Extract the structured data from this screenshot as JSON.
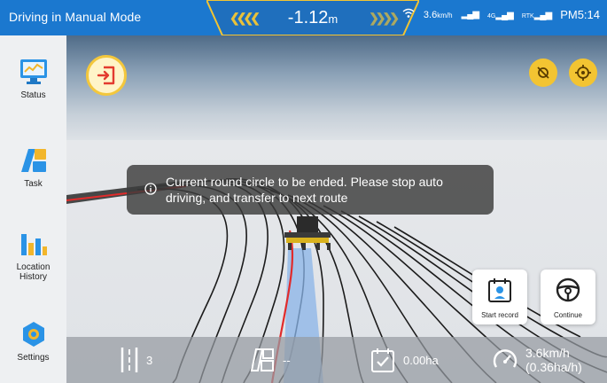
{
  "topbar": {
    "mode_title": "Driving in Manual Mode",
    "offset_value": "-1.12",
    "offset_unit": "m",
    "speed_small": "3.6",
    "speed_small_unit": "km/h",
    "net_label": "4G",
    "rtk_label": "RTK",
    "time": "PM5:14"
  },
  "sidebar": {
    "items": [
      {
        "label": "Status"
      },
      {
        "label": "Task"
      },
      {
        "label": "Location History"
      },
      {
        "label": "Settings"
      }
    ]
  },
  "toast": {
    "message": "Current round circle to be ended. Please stop auto driving, and transfer to next route"
  },
  "actions": {
    "start_record": "Start record",
    "continue": "Continue"
  },
  "bottom": {
    "line_count": "3",
    "area_name": "--",
    "worked_area": "0.00ha",
    "speed": "3.6km/h",
    "rate": "(0.36ha/h)"
  },
  "colors": {
    "accent_blue": "#1b78cf",
    "accent_yellow": "#f3c432",
    "guide_red": "#e12b2b"
  }
}
